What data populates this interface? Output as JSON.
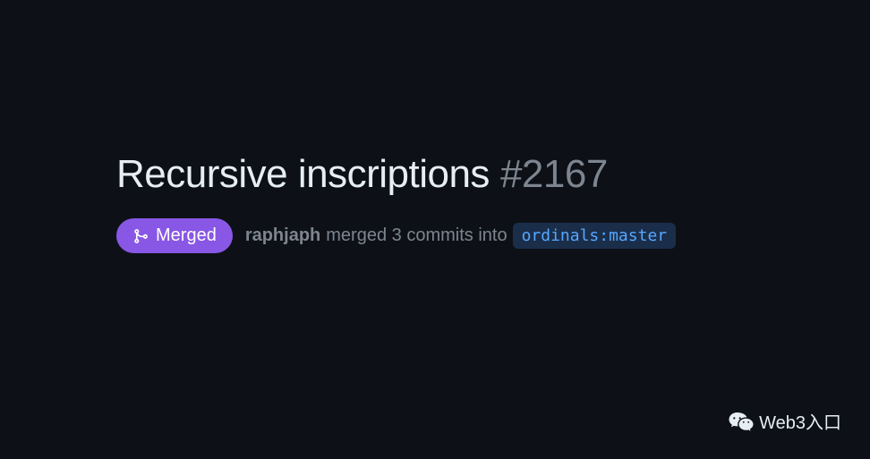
{
  "pr": {
    "title": "Recursive inscriptions",
    "number": "#2167"
  },
  "status": {
    "label": "Merged"
  },
  "meta": {
    "author": "raphjaph",
    "action": "merged 3 commits into",
    "branch": "ordinals:master"
  },
  "watermark": {
    "text": "Web3入口"
  }
}
